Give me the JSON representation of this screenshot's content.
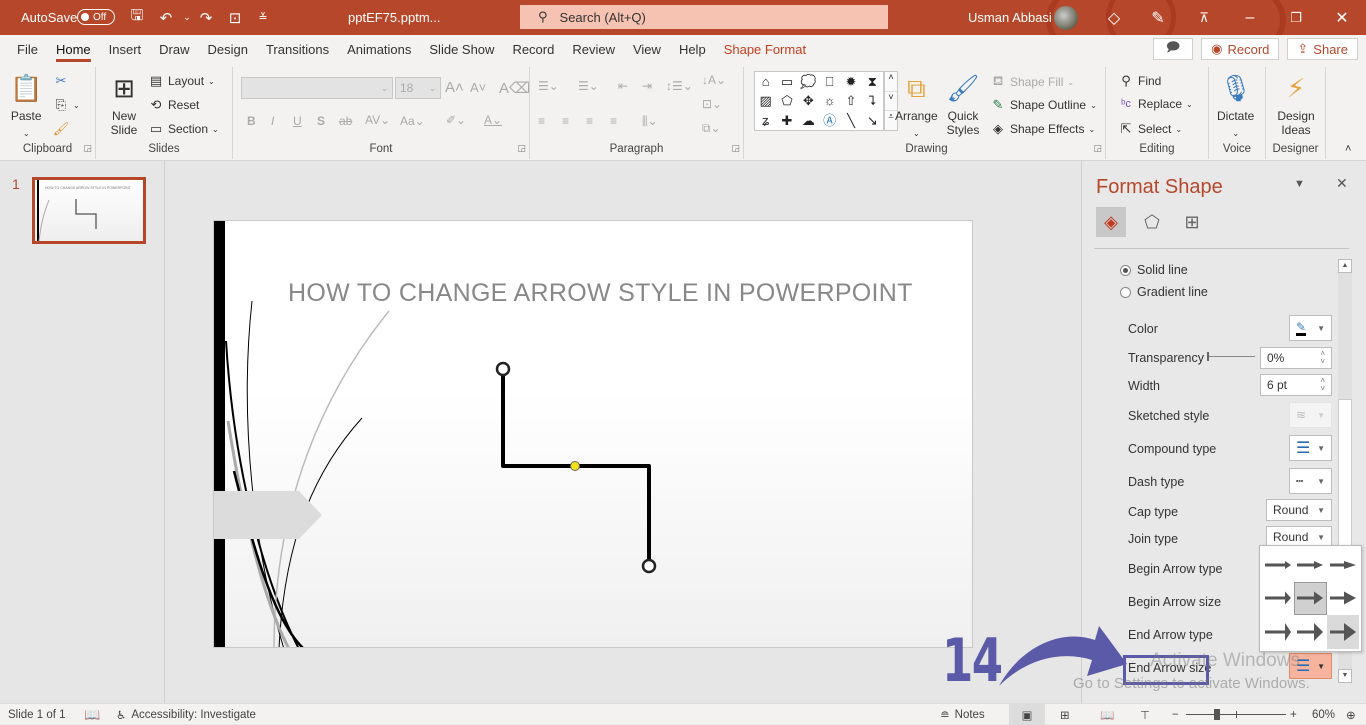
{
  "titlebar": {
    "autosave_label": "AutoSave",
    "autosave_state": "Off",
    "filename": "pptEF75.pptm...",
    "search_placeholder": "Search (Alt+Q)",
    "user_name": "Usman Abbasi",
    "qat_icons": [
      "save-icon",
      "undo-icon",
      "redo-icon",
      "present-icon",
      "customize-icon"
    ]
  },
  "tabs": [
    {
      "label": "File"
    },
    {
      "label": "Home",
      "active": true
    },
    {
      "label": "Insert"
    },
    {
      "label": "Draw"
    },
    {
      "label": "Design"
    },
    {
      "label": "Transitions"
    },
    {
      "label": "Animations"
    },
    {
      "label": "Slide Show"
    },
    {
      "label": "Record"
    },
    {
      "label": "Review"
    },
    {
      "label": "View"
    },
    {
      "label": "Help"
    },
    {
      "label": "Shape Format",
      "contextual": true
    }
  ],
  "tab_actions": {
    "record": "Record",
    "share": "Share"
  },
  "ribbon": {
    "clipboard": {
      "label": "Clipboard",
      "paste": "Paste"
    },
    "slides": {
      "label": "Slides",
      "new_slide": "New Slide",
      "layout": "Layout",
      "reset": "Reset",
      "section": "Section"
    },
    "font": {
      "label": "Font",
      "font_name": "",
      "font_size": "18"
    },
    "paragraph": {
      "label": "Paragraph"
    },
    "drawing": {
      "label": "Drawing",
      "arrange": "Arrange",
      "quick_styles": "Quick Styles",
      "shape_fill": "Shape Fill",
      "shape_outline": "Shape Outline",
      "shape_effects": "Shape Effects"
    },
    "editing": {
      "label": "Editing",
      "find": "Find",
      "replace": "Replace",
      "select": "Select"
    },
    "voice": {
      "label": "Voice",
      "dictate": "Dictate"
    },
    "designer": {
      "label": "Designer",
      "design_ideas": "Design Ideas"
    }
  },
  "thumbnails": [
    {
      "number": "1",
      "title": "HOW TO CHANGE ARROW STYLE IN POWERPOINT"
    }
  ],
  "slide": {
    "title": "HOW TO CHANGE ARROW STYLE IN POWERPOINT"
  },
  "format_pane": {
    "title": "Format Shape",
    "line_options": [
      {
        "label": "Solid line",
        "selected": true
      },
      {
        "label": "Gradient line",
        "selected": false
      }
    ],
    "color_label": "Color",
    "transparency_label": "Transparency",
    "transparency_value": "0%",
    "width_label": "Width",
    "width_value": "6 pt",
    "sketched_label": "Sketched style",
    "compound_label": "Compound type",
    "dash_label": "Dash type",
    "cap_label": "Cap type",
    "cap_value": "Round",
    "join_label": "Join type",
    "join_value": "Round",
    "begin_arrow_type_label": "Begin Arrow type",
    "begin_arrow_size_label": "Begin Arrow size",
    "end_arrow_type_label": "End Arrow type",
    "end_arrow_size_label": "End Arrow size"
  },
  "arrow_size_popup": {
    "selected_index": 4,
    "hovered_index": 8,
    "sizes": 9
  },
  "annotation": {
    "step": "14"
  },
  "watermark": {
    "line1": "Activate Windows",
    "line2": "Go to Settings to activate Windows."
  },
  "statusbar": {
    "slide_info": "Slide 1 of 1",
    "accessibility": "Accessibility: Investigate",
    "notes": "Notes",
    "zoom": "60%"
  },
  "colors": {
    "accent": "#b7472a",
    "annotation": "#5a5aa8"
  }
}
